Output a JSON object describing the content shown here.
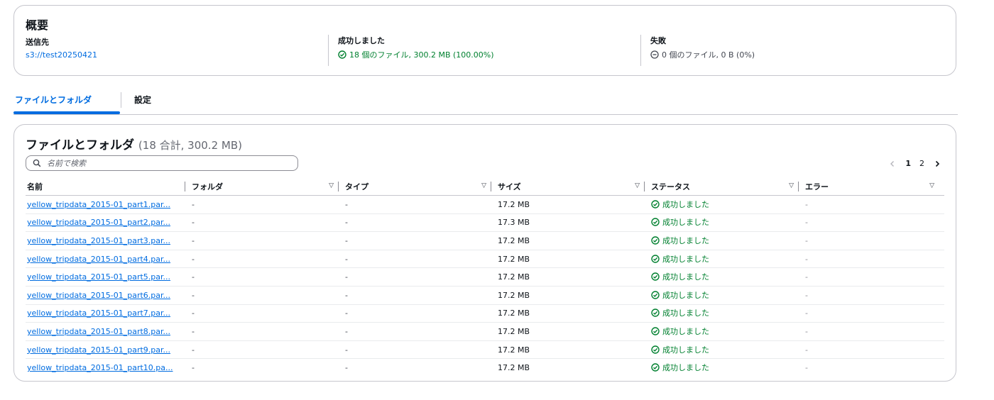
{
  "summary": {
    "title": "概要",
    "destination": {
      "label": "送信先",
      "value": "s3://test20250421"
    },
    "succeeded": {
      "label": "成功しました",
      "value": "18 個のファイル, 300.2 MB (100.00%)"
    },
    "failed": {
      "label": "失敗",
      "value": "0 個のファイル, 0 B (0%)"
    }
  },
  "tabs": {
    "files": "ファイルとフォルダ",
    "settings": "設定"
  },
  "files": {
    "title": "ファイルとフォルダ",
    "count": "(18 合計, 300.2 MB)",
    "search_placeholder": "名前で検索",
    "pager": {
      "prev": "‹",
      "pages": [
        "1",
        "2"
      ],
      "next": "›"
    },
    "columns": [
      "名前",
      "フォルダ",
      "タイプ",
      "サイズ",
      "ステータス",
      "エラー"
    ],
    "rows": [
      {
        "name": "yellow_tripdata_2015-01_part1.par...",
        "folder": "-",
        "type": "-",
        "size": "17.2 MB",
        "status": "成功しました",
        "error": "-"
      },
      {
        "name": "yellow_tripdata_2015-01_part2.par...",
        "folder": "-",
        "type": "-",
        "size": "17.3 MB",
        "status": "成功しました",
        "error": "-"
      },
      {
        "name": "yellow_tripdata_2015-01_part3.par...",
        "folder": "-",
        "type": "-",
        "size": "17.2 MB",
        "status": "成功しました",
        "error": "-"
      },
      {
        "name": "yellow_tripdata_2015-01_part4.par...",
        "folder": "-",
        "type": "-",
        "size": "17.2 MB",
        "status": "成功しました",
        "error": "-"
      },
      {
        "name": "yellow_tripdata_2015-01_part5.par...",
        "folder": "-",
        "type": "-",
        "size": "17.2 MB",
        "status": "成功しました",
        "error": "-"
      },
      {
        "name": "yellow_tripdata_2015-01_part6.par...",
        "folder": "-",
        "type": "-",
        "size": "17.2 MB",
        "status": "成功しました",
        "error": "-"
      },
      {
        "name": "yellow_tripdata_2015-01_part7.par...",
        "folder": "-",
        "type": "-",
        "size": "17.2 MB",
        "status": "成功しました",
        "error": "-"
      },
      {
        "name": "yellow_tripdata_2015-01_part8.par...",
        "folder": "-",
        "type": "-",
        "size": "17.2 MB",
        "status": "成功しました",
        "error": "-"
      },
      {
        "name": "yellow_tripdata_2015-01_part9.par...",
        "folder": "-",
        "type": "-",
        "size": "17.2 MB",
        "status": "成功しました",
        "error": "-"
      },
      {
        "name": "yellow_tripdata_2015-01_part10.pa...",
        "folder": "-",
        "type": "-",
        "size": "17.2 MB",
        "status": "成功しました",
        "error": "-"
      }
    ]
  },
  "colors": {
    "link": "#006ce0",
    "success": "#00802f",
    "border": "#c6c6cd"
  }
}
